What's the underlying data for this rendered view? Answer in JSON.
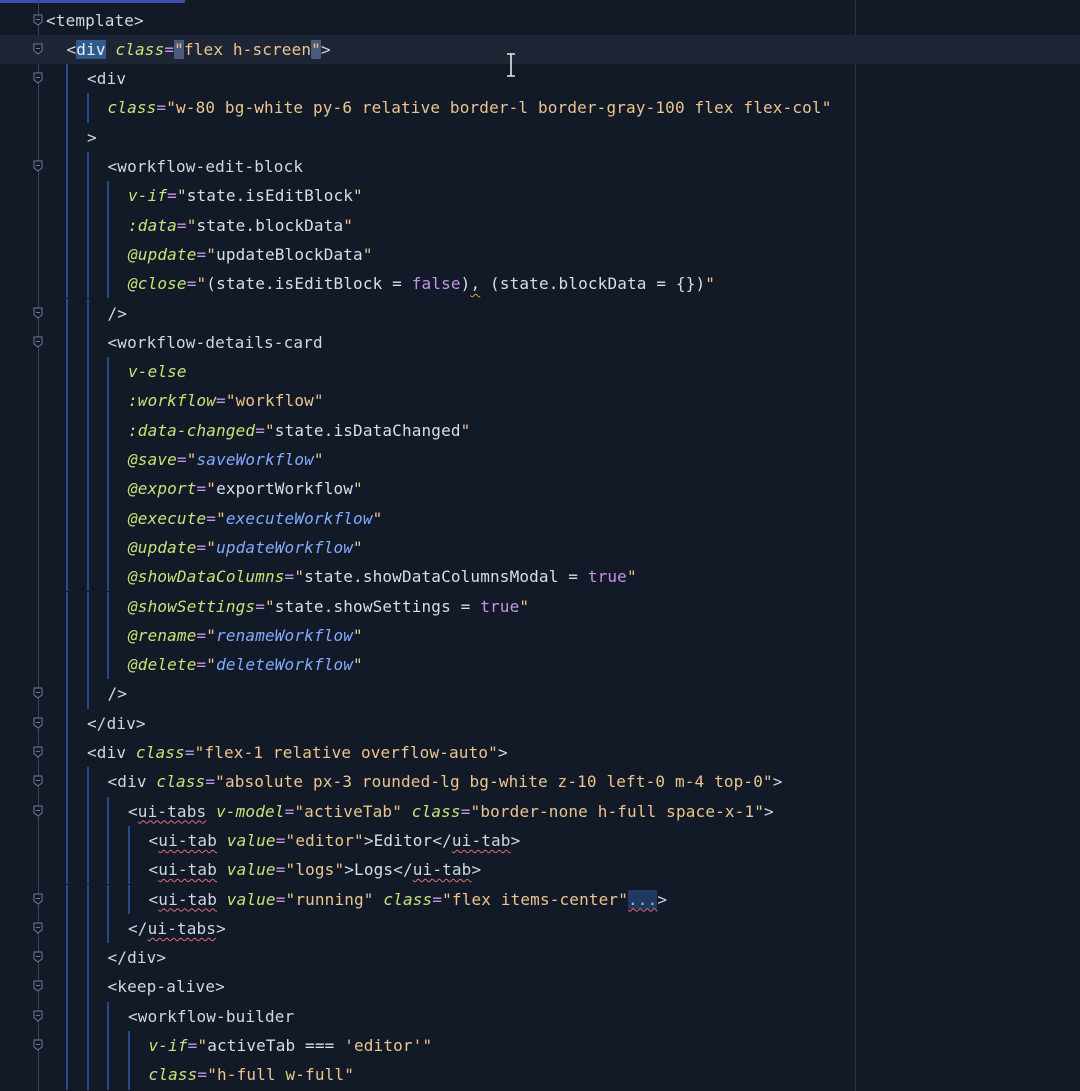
{
  "editor": {
    "file_type": "vue-template",
    "colors": {
      "background": "#131a27",
      "tag": "#cfd6e4",
      "attribute": "#c5e478",
      "string": "#ecc48d",
      "keyword": "#c792ea",
      "function": "#82aaff"
    },
    "lines": [
      {
        "indent": 0,
        "tokens": [
          [
            "tag",
            "<template>"
          ]
        ]
      },
      {
        "indent": 1,
        "tokens": [
          [
            "tag",
            "<"
          ],
          [
            "tag hl-box",
            "div"
          ],
          [
            "tag",
            " "
          ],
          [
            "attr",
            "class"
          ],
          [
            "eq",
            "="
          ],
          [
            "q hl-q",
            "\""
          ],
          [
            "str",
            "flex h-screen"
          ],
          [
            "q hl-q",
            "\""
          ],
          [
            "tag",
            ">"
          ]
        ]
      },
      {
        "indent": 2,
        "tokens": [
          [
            "tag",
            "<div"
          ]
        ]
      },
      {
        "indent": 3,
        "tokens": [
          [
            "attr",
            "class"
          ],
          [
            "eq",
            "="
          ],
          [
            "q",
            "\""
          ],
          [
            "str",
            "w-80 bg-white py-6 relative border-l border-gray-100 flex flex-col"
          ],
          [
            "q",
            "\""
          ]
        ]
      },
      {
        "indent": 2,
        "tokens": [
          [
            "tag",
            ">"
          ]
        ]
      },
      {
        "indent": 3,
        "tokens": [
          [
            "tag",
            "<workflow-edit-block"
          ]
        ]
      },
      {
        "indent": 4,
        "tokens": [
          [
            "attr",
            "v-if"
          ],
          [
            "eq",
            "="
          ],
          [
            "q",
            "\""
          ],
          [
            "expr",
            "state.isEditBlock"
          ],
          [
            "q",
            "\""
          ]
        ]
      },
      {
        "indent": 4,
        "tokens": [
          [
            "attr",
            ":data"
          ],
          [
            "eq",
            "="
          ],
          [
            "q",
            "\""
          ],
          [
            "expr",
            "state.blockData"
          ],
          [
            "q",
            "\""
          ]
        ]
      },
      {
        "indent": 4,
        "tokens": [
          [
            "attr",
            "@update"
          ],
          [
            "eq",
            "="
          ],
          [
            "q",
            "\""
          ],
          [
            "expr",
            "updateBlockData"
          ],
          [
            "q",
            "\""
          ]
        ]
      },
      {
        "indent": 4,
        "tokens": [
          [
            "attr",
            "@close"
          ],
          [
            "eq",
            "="
          ],
          [
            "q",
            "\""
          ],
          [
            "expr",
            "(state.isEditBlock = "
          ],
          [
            "kw",
            "false"
          ],
          [
            "expr",
            ")"
          ],
          [
            "expr wavy-y",
            ","
          ],
          [
            "expr",
            " (state.blockData = {})"
          ],
          [
            "q",
            "\""
          ]
        ]
      },
      {
        "indent": 3,
        "tokens": [
          [
            "tag",
            "/>"
          ]
        ]
      },
      {
        "indent": 3,
        "tokens": [
          [
            "tag",
            "<workflow-details-card"
          ]
        ]
      },
      {
        "indent": 4,
        "tokens": [
          [
            "attr",
            "v-else"
          ]
        ]
      },
      {
        "indent": 4,
        "tokens": [
          [
            "attr",
            ":workflow"
          ],
          [
            "eq",
            "="
          ],
          [
            "q",
            "\""
          ],
          [
            "str",
            "workflow"
          ],
          [
            "q",
            "\""
          ]
        ]
      },
      {
        "indent": 4,
        "tokens": [
          [
            "attr",
            ":data-changed"
          ],
          [
            "eq",
            "="
          ],
          [
            "q",
            "\""
          ],
          [
            "expr",
            "state.isDataChanged"
          ],
          [
            "q",
            "\""
          ]
        ]
      },
      {
        "indent": 4,
        "tokens": [
          [
            "attr",
            "@save"
          ],
          [
            "eq",
            "="
          ],
          [
            "q",
            "\""
          ],
          [
            "fn",
            "saveWorkflow"
          ],
          [
            "q",
            "\""
          ]
        ]
      },
      {
        "indent": 4,
        "tokens": [
          [
            "attr",
            "@export"
          ],
          [
            "eq",
            "="
          ],
          [
            "q",
            "\""
          ],
          [
            "plain",
            "exportWorkflow"
          ],
          [
            "q",
            "\""
          ]
        ]
      },
      {
        "indent": 4,
        "tokens": [
          [
            "attr",
            "@execute"
          ],
          [
            "eq",
            "="
          ],
          [
            "q",
            "\""
          ],
          [
            "fn",
            "executeWorkflow"
          ],
          [
            "q",
            "\""
          ]
        ]
      },
      {
        "indent": 4,
        "tokens": [
          [
            "attr",
            "@update"
          ],
          [
            "eq",
            "="
          ],
          [
            "q",
            "\""
          ],
          [
            "fn",
            "updateWorkflow"
          ],
          [
            "q",
            "\""
          ]
        ]
      },
      {
        "indent": 4,
        "tokens": [
          [
            "attr",
            "@showDataColumns"
          ],
          [
            "eq",
            "="
          ],
          [
            "q",
            "\""
          ],
          [
            "expr",
            "state.showDataColumnsModal = "
          ],
          [
            "kw",
            "true"
          ],
          [
            "q",
            "\""
          ]
        ]
      },
      {
        "indent": 4,
        "tokens": [
          [
            "attr",
            "@showSettings"
          ],
          [
            "eq",
            "="
          ],
          [
            "q",
            "\""
          ],
          [
            "expr",
            "state.showSettings = "
          ],
          [
            "kw",
            "true"
          ],
          [
            "q",
            "\""
          ]
        ]
      },
      {
        "indent": 4,
        "tokens": [
          [
            "attr",
            "@rename"
          ],
          [
            "eq",
            "="
          ],
          [
            "q",
            "\""
          ],
          [
            "fn",
            "renameWorkflow"
          ],
          [
            "q",
            "\""
          ]
        ]
      },
      {
        "indent": 4,
        "tokens": [
          [
            "attr",
            "@delete"
          ],
          [
            "eq",
            "="
          ],
          [
            "q",
            "\""
          ],
          [
            "fn",
            "deleteWorkflow"
          ],
          [
            "q",
            "\""
          ]
        ]
      },
      {
        "indent": 3,
        "tokens": [
          [
            "tag",
            "/>"
          ]
        ]
      },
      {
        "indent": 2,
        "tokens": [
          [
            "tag",
            "</div>"
          ]
        ]
      },
      {
        "indent": 2,
        "tokens": [
          [
            "tag",
            "<div "
          ],
          [
            "attr",
            "class"
          ],
          [
            "eq",
            "="
          ],
          [
            "q",
            "\""
          ],
          [
            "str",
            "flex-1 relative overflow-auto"
          ],
          [
            "q",
            "\""
          ],
          [
            "tag",
            ">"
          ]
        ]
      },
      {
        "indent": 3,
        "tokens": [
          [
            "tag",
            "<div "
          ],
          [
            "attr",
            "class"
          ],
          [
            "eq",
            "="
          ],
          [
            "q",
            "\""
          ],
          [
            "str",
            "absolute px-3 rounded-lg bg-white z-10 left-0 m-4 top-0"
          ],
          [
            "q",
            "\""
          ],
          [
            "tag",
            ">"
          ]
        ]
      },
      {
        "indent": 4,
        "tokens": [
          [
            "tag",
            "<"
          ],
          [
            "tag wavy",
            "ui-tabs"
          ],
          [
            "tag",
            " "
          ],
          [
            "attr",
            "v-model"
          ],
          [
            "eq",
            "="
          ],
          [
            "q",
            "\""
          ],
          [
            "str",
            "activeTab"
          ],
          [
            "q",
            "\""
          ],
          [
            "tag",
            " "
          ],
          [
            "attr",
            "class"
          ],
          [
            "eq",
            "="
          ],
          [
            "q",
            "\""
          ],
          [
            "str",
            "border-none h-full space-x-1"
          ],
          [
            "q",
            "\""
          ],
          [
            "tag",
            ">"
          ]
        ]
      },
      {
        "indent": 5,
        "tokens": [
          [
            "tag",
            "<"
          ],
          [
            "tag wavy",
            "ui-tab"
          ],
          [
            "tag",
            " "
          ],
          [
            "attr",
            "value"
          ],
          [
            "eq",
            "="
          ],
          [
            "q",
            "\""
          ],
          [
            "str",
            "editor"
          ],
          [
            "q",
            "\""
          ],
          [
            "tag",
            ">"
          ],
          [
            "plain",
            "Editor"
          ],
          [
            "tag",
            "</"
          ],
          [
            "tag wavy",
            "ui-tab"
          ],
          [
            "tag",
            ">"
          ]
        ]
      },
      {
        "indent": 5,
        "tokens": [
          [
            "tag",
            "<"
          ],
          [
            "tag wavy",
            "ui-tab"
          ],
          [
            "tag",
            " "
          ],
          [
            "attr",
            "value"
          ],
          [
            "eq",
            "="
          ],
          [
            "q",
            "\""
          ],
          [
            "str",
            "logs"
          ],
          [
            "q",
            "\""
          ],
          [
            "tag",
            ">"
          ],
          [
            "plain",
            "Logs"
          ],
          [
            "tag",
            "</"
          ],
          [
            "tag wavy",
            "ui-tab"
          ],
          [
            "tag",
            ">"
          ]
        ]
      },
      {
        "indent": 5,
        "tokens": [
          [
            "tag",
            "<"
          ],
          [
            "tag wavy",
            "ui-tab"
          ],
          [
            "tag",
            " "
          ],
          [
            "attr",
            "value"
          ],
          [
            "eq",
            "="
          ],
          [
            "q",
            "\""
          ],
          [
            "str",
            "running"
          ],
          [
            "q",
            "\""
          ],
          [
            "tag",
            " "
          ],
          [
            "attr",
            "class"
          ],
          [
            "eq",
            "="
          ],
          [
            "q",
            "\""
          ],
          [
            "str",
            "flex items-center"
          ],
          [
            "q",
            "\""
          ],
          [
            "ellipsis wavy",
            "..."
          ],
          [
            "tag",
            ">"
          ]
        ]
      },
      {
        "indent": 4,
        "tokens": [
          [
            "tag",
            "</"
          ],
          [
            "tag wavy",
            "ui-tabs"
          ],
          [
            "tag",
            ">"
          ]
        ]
      },
      {
        "indent": 3,
        "tokens": [
          [
            "tag",
            "</div>"
          ]
        ]
      },
      {
        "indent": 3,
        "tokens": [
          [
            "tag",
            "<keep-alive>"
          ]
        ]
      },
      {
        "indent": 4,
        "tokens": [
          [
            "tag",
            "<workflow-builder"
          ]
        ]
      },
      {
        "indent": 5,
        "tokens": [
          [
            "attr",
            "v-if"
          ],
          [
            "eq",
            "="
          ],
          [
            "q",
            "\""
          ],
          [
            "expr",
            "activeTab === "
          ],
          [
            "sq",
            "'editor'"
          ],
          [
            "q",
            "\""
          ]
        ]
      },
      {
        "indent": 5,
        "tokens": [
          [
            "attr",
            "class"
          ],
          [
            "eq",
            "="
          ],
          [
            "q",
            "\""
          ],
          [
            "str",
            "h-full w-full"
          ],
          [
            "q",
            "\""
          ]
        ]
      }
    ]
  }
}
